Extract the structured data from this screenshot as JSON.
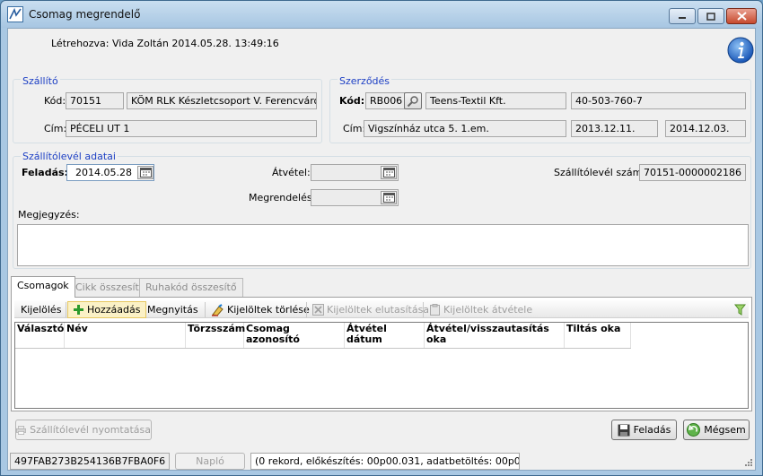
{
  "window": {
    "title": "Csomag megrendelő",
    "colors": {
      "frame": "#a9c8e3",
      "group_title": "#1c3fc4"
    }
  },
  "header": {
    "created_by": "Létrehozva: Vida Zoltán 2014.05.28. 13:49:16",
    "info_icon": "info-icon"
  },
  "supplier": {
    "title": "Szállító",
    "code_label": "Kód:",
    "code": "70151",
    "name": "KÖM RLK Készletcsoport V. Ferencváros",
    "address_label": "Cím:",
    "address": "PÉCELI UT 1"
  },
  "contract": {
    "title": "Szerződés",
    "code_label": "Kód:",
    "code": "RB006",
    "partner": "Teens-Textil Kft.",
    "number": "40-503-760-7",
    "address_label": "Cím:",
    "address": "Vigszínház utca 5. 1.em.",
    "date_from": "2013.12.11.",
    "date_to": "2014.12.03."
  },
  "delivery_note": {
    "title": "Szállítólevél adatai",
    "dispatch_label": "Feladás:",
    "dispatch_date": "2014.05.28",
    "receipt_label": "Átvétel:",
    "receipt_date": "",
    "order_label": "Megrendelés:",
    "order_date": "",
    "number_label": "Szállítólevél száma:",
    "number": "70151-0000002186",
    "comment_label": "Megjegyzés:",
    "comment": ""
  },
  "tabs": [
    {
      "label": "Csomagok",
      "active": true
    },
    {
      "label": "Cikk összesítő",
      "active": false
    },
    {
      "label": "Ruhakód összesítő",
      "active": false
    }
  ],
  "toolbar": {
    "select": "Kijelölés",
    "add": "Hozzáadás",
    "open": "Megnyitás",
    "delete_selected": "Kijelöltek törlése",
    "reject_selected": "Kijelöltek elutasítása",
    "receive_selected": "Kijelöltek átvétele"
  },
  "grid": {
    "columns": [
      {
        "label": "Választó"
      },
      {
        "label": "Név"
      },
      {
        "label": "Törzsszám"
      },
      {
        "label": "Csomag azonosító"
      },
      {
        "label": "Átvétel dátum"
      },
      {
        "label": "Átvétel/visszautasítás oka"
      },
      {
        "label": "Tiltás oka"
      }
    ],
    "rows": []
  },
  "buttons": {
    "print": "Szállítólevél nyomtatása",
    "dispatch": "Feladás",
    "cancel": "Mégsem"
  },
  "status": {
    "id": "497FAB273B254136B7FBA0F6",
    "log_button": "Napló",
    "info": "(0 rekord, előkészítés: 00p00.031, adatbetöltés: 00p00.000)"
  }
}
